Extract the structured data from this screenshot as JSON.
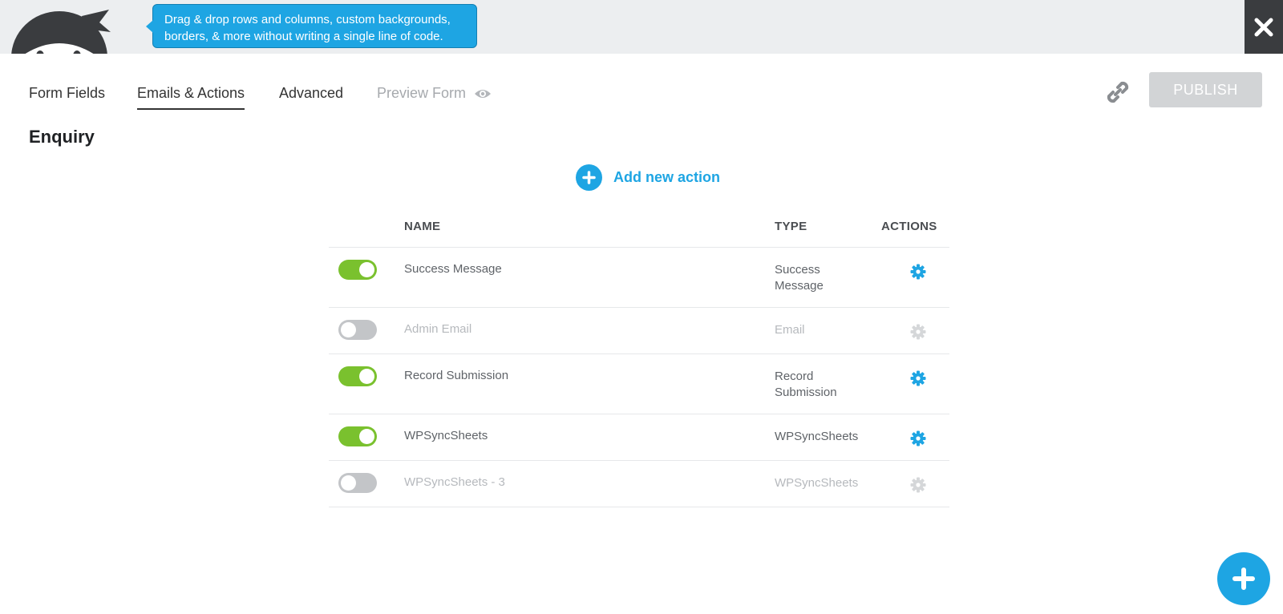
{
  "promo": {
    "text_line1": "Drag & drop rows and columns, custom backgrounds,",
    "text_line2": "borders, & more without writing a single line of code."
  },
  "tabs": [
    {
      "label": "Form Fields"
    },
    {
      "label": "Emails & Actions",
      "active": true
    },
    {
      "label": "Advanced"
    },
    {
      "label": "Preview Form"
    }
  ],
  "header": {
    "publish_label": "PUBLISH"
  },
  "form": {
    "title": "Enquiry"
  },
  "actions_area": {
    "add_label": "Add new action"
  },
  "table": {
    "columns": {
      "name": "NAME",
      "type": "TYPE",
      "actions": "ACTIONS"
    },
    "rows": [
      {
        "name": "Success Message",
        "type_line1": "Success",
        "type_line2": "Message",
        "enabled": true
      },
      {
        "name": "Admin Email",
        "type_line1": "Email",
        "type_line2": "",
        "enabled": false
      },
      {
        "name": "Record Submission",
        "type_line1": "Record",
        "type_line2": "Submission",
        "enabled": true
      },
      {
        "name": "WPSyncSheets",
        "type_line1": "WPSyncSheets",
        "type_line2": "",
        "enabled": true
      },
      {
        "name": "WPSyncSheets - 3",
        "type_line1": "WPSyncSheets",
        "type_line2": "",
        "enabled": false
      }
    ]
  },
  "colors": {
    "accent": "#1ea5e3",
    "toggle_on": "#7ac12e",
    "toggle_off": "#c3c5c8",
    "disabled_gear": "#d5d7d9"
  },
  "icons": [
    "ninja-mascot-icon",
    "close-icon",
    "eye-icon",
    "link-icon",
    "plus-icon",
    "gear-icon"
  ]
}
